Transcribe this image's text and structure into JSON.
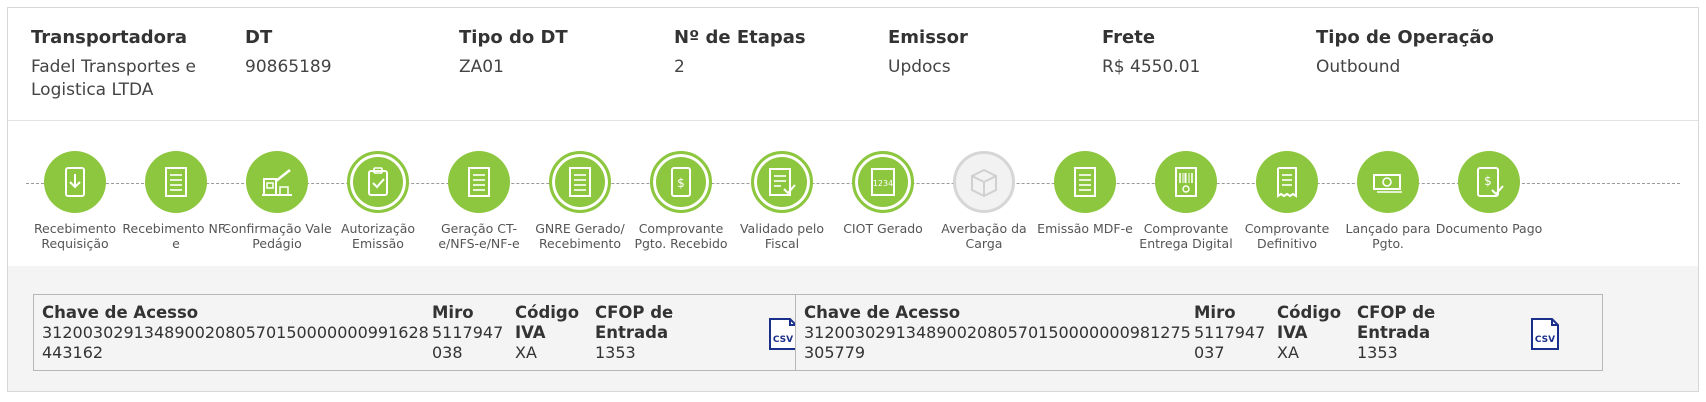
{
  "header": {
    "fields": [
      {
        "label": "Transportadora",
        "value": "Fadel Transportes e Logistica LTDA"
      },
      {
        "label": "DT",
        "value": "90865189"
      },
      {
        "label": "Tipo do DT",
        "value": "ZA01"
      },
      {
        "label": "Nº de Etapas",
        "value": "2"
      },
      {
        "label": "Emissor",
        "value": "Updocs"
      },
      {
        "label": "Frete",
        "value": "R$ 4550.01"
      },
      {
        "label": "Tipo de Operação",
        "value": "Outbound"
      }
    ]
  },
  "timeline": {
    "steps": [
      {
        "label": "Recebimento Requisição",
        "icon": "download-document-icon",
        "status": "done"
      },
      {
        "label": "Recebimento NF-e",
        "icon": "document-lines-icon",
        "status": "done"
      },
      {
        "label": "Confirmação Vale Pedágio",
        "icon": "toll-gate-icon",
        "status": "done"
      },
      {
        "label": "Autorização Emissão",
        "icon": "clipboard-check-icon",
        "status": "done-outline"
      },
      {
        "label": "Geração CT-e/NFS-e/NF-e",
        "icon": "document-lines-icon",
        "status": "done"
      },
      {
        "label": "GNRE Gerado/ Recebimento",
        "icon": "document-lines-icon",
        "status": "done-outline"
      },
      {
        "label": "Comprovante Pgto. Recebido",
        "icon": "receipt-dollar-icon",
        "status": "done-outline"
      },
      {
        "label": "Validado pelo Fiscal",
        "icon": "document-check-icon",
        "status": "done-outline"
      },
      {
        "label": "CIOT Gerado",
        "icon": "ciot-number-icon",
        "status": "done-outline"
      },
      {
        "label": "Averbação da Carga",
        "icon": "box-icon",
        "status": "pending"
      },
      {
        "label": "Emissão MDF-e",
        "icon": "document-lines-icon",
        "status": "done"
      },
      {
        "label": "Comprovante Entrega Digital",
        "icon": "barcode-document-icon",
        "status": "done"
      },
      {
        "label": "Comprovante Definitivo",
        "icon": "receipt-icon",
        "status": "done"
      },
      {
        "label": "Lançado para Pgto.",
        "icon": "money-bill-icon",
        "status": "done"
      },
      {
        "label": "Documento Pago",
        "icon": "paid-document-icon",
        "status": "done"
      }
    ],
    "colors": {
      "done": "#8dc63f",
      "pending": "#d6d6d6"
    }
  },
  "cards": [
    {
      "chave_label": "Chave de Acesso",
      "chave_value": "31200302913489002080570150000000991628443162",
      "miro_label": "Miro",
      "miro_value": "5117947038",
      "iva_label": "Código IVA",
      "iva_value": "XA",
      "cfop_label": "CFOP de Entrada",
      "cfop_value": "1353",
      "icon": "csv-file-icon",
      "icon_text": "CSV"
    },
    {
      "chave_label": "Chave de Acesso",
      "chave_value": "31200302913489002080570150000000981275305779",
      "miro_label": "Miro",
      "miro_value": "5117947037",
      "iva_label": "Código IVA",
      "iva_value": "XA",
      "cfop_label": "CFOP de Entrada",
      "cfop_value": "1353",
      "icon": "csv-file-icon",
      "icon_text": "CSV"
    }
  ]
}
